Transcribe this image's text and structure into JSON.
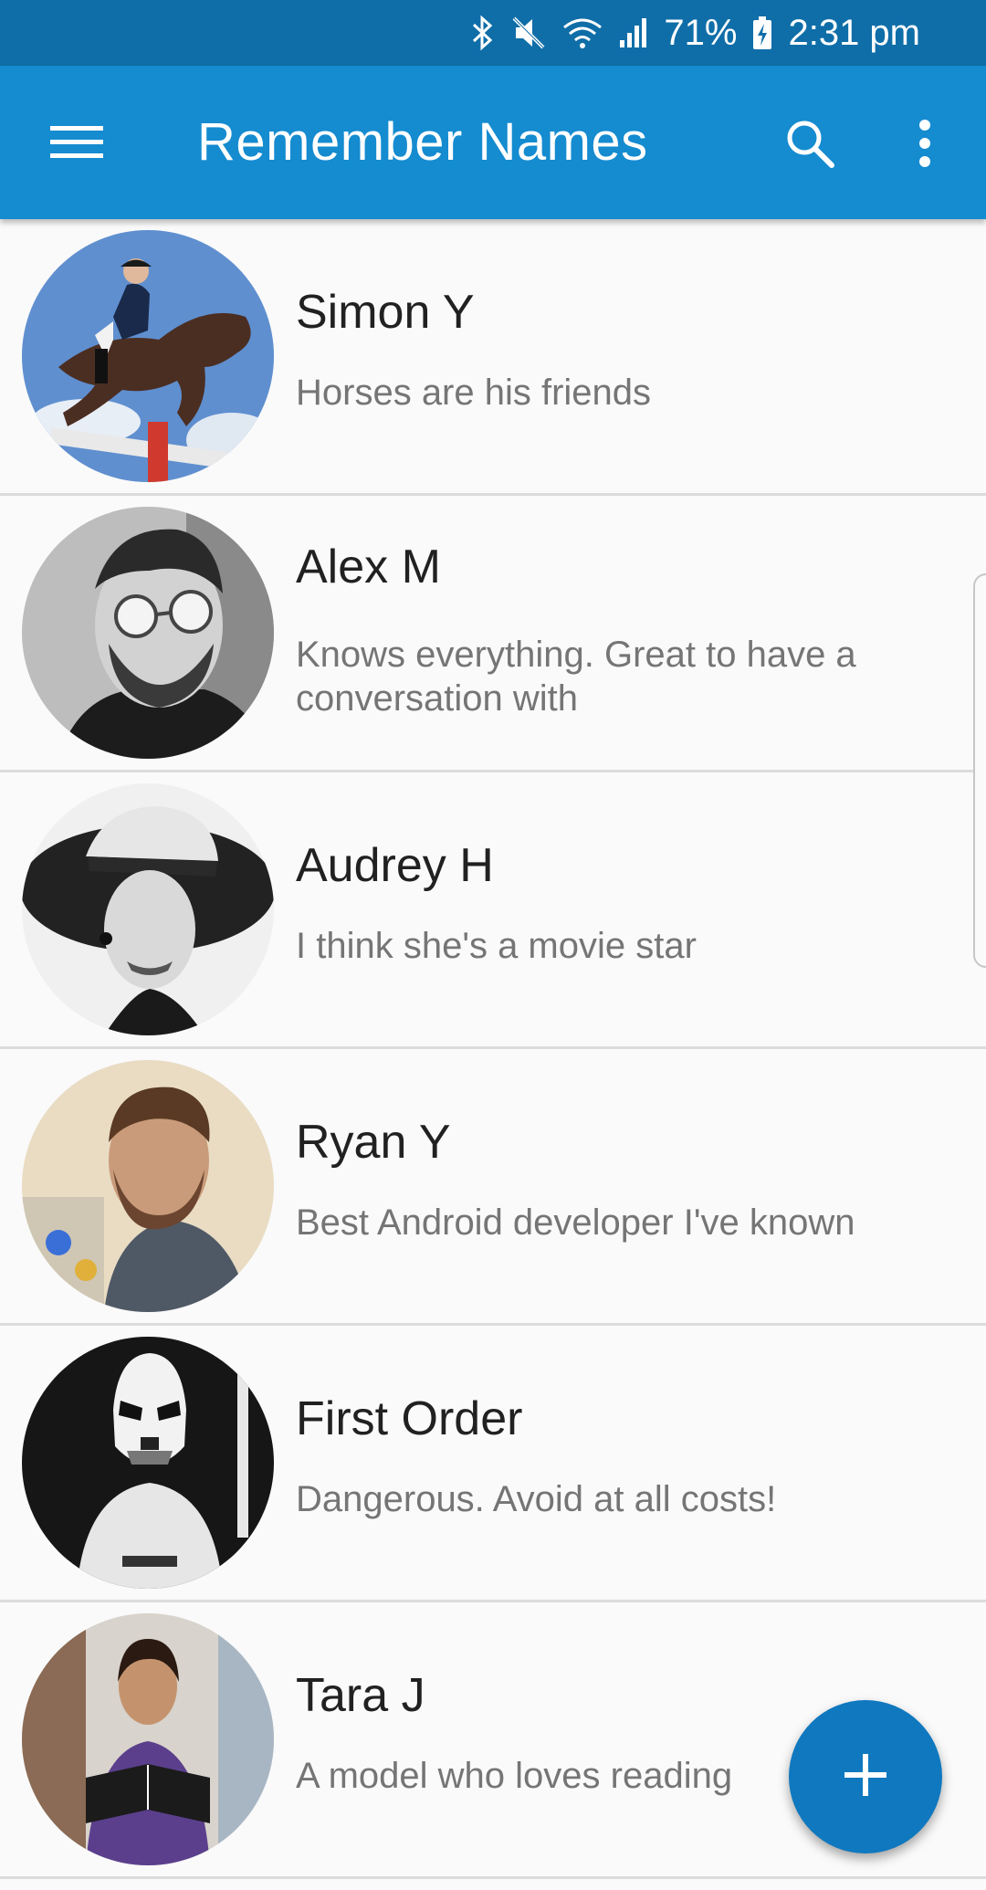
{
  "status_bar": {
    "battery": "71%",
    "time": "2:31 pm",
    "icons": [
      "bluetooth-icon",
      "mute-icon",
      "wifi-icon",
      "signal-icon",
      "battery-charging-icon"
    ]
  },
  "app_bar": {
    "title": "Remember Names",
    "menu_icon": "hamburger-menu-icon",
    "search_icon": "search-icon",
    "more_icon": "more-vert-icon",
    "color": "#158bd0"
  },
  "people": [
    {
      "name": "Simon Y",
      "note": "Horses are his friends"
    },
    {
      "name": "Alex M",
      "note": "Knows everything.  Great to have a conversation with"
    },
    {
      "name": "Audrey H",
      "note": "I think she's a movie star"
    },
    {
      "name": "Ryan Y",
      "note": "Best Android developer I've known"
    },
    {
      "name": "First Order",
      "note": "Dangerous. Avoid at all costs!"
    },
    {
      "name": "Tara J",
      "note": "A model who loves reading"
    }
  ],
  "fab": {
    "icon": "plus-icon",
    "color": "#0f78bf"
  }
}
